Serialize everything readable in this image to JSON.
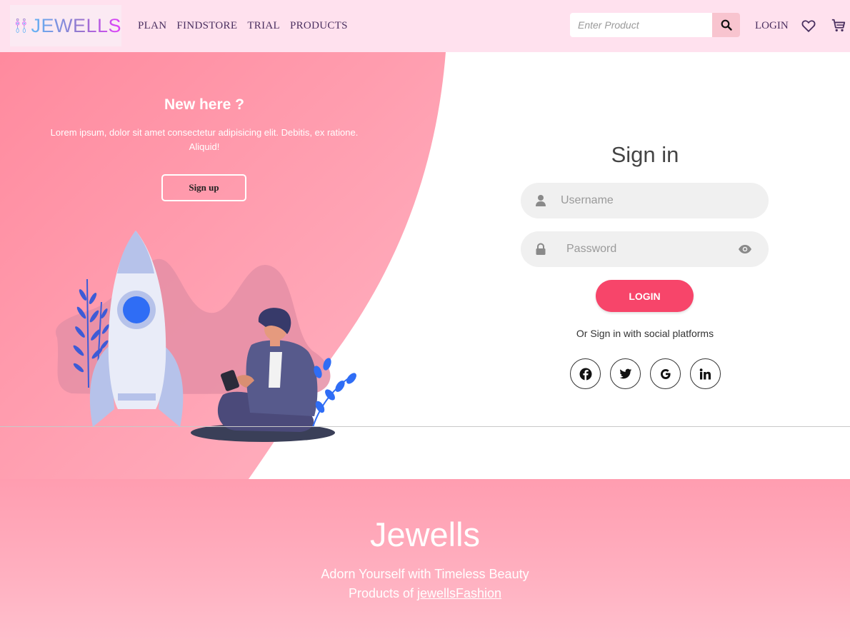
{
  "header": {
    "brand": "JEWELLS",
    "nav": [
      "PLAN",
      "FINDSTORE",
      "TRIAL",
      "PRODUCTS"
    ],
    "search_placeholder": "Enter Product",
    "login_label": "LOGIN",
    "icons": [
      "search-icon",
      "heart-icon",
      "cart-icon"
    ]
  },
  "welcome": {
    "title": "New here ?",
    "text": "Lorem ipsum, dolor sit amet consectetur adipisicing elit. Debitis, ex ratione. Aliquid!",
    "signup_label": "Sign up"
  },
  "signin": {
    "title": "Sign in",
    "username_placeholder": "Username",
    "password_placeholder": "Password",
    "login_label": "LOGIN",
    "social_text": "Or Sign in with social platforms",
    "social": [
      "facebook-icon",
      "twitter-icon",
      "google-icon",
      "linkedin-icon"
    ]
  },
  "footer": {
    "brand": "Jewells",
    "tagline": "Adorn Yourself with Timeless Beauty",
    "credit_prefix": "Products of ",
    "credit_link": "jewellsFashion"
  },
  "colors": {
    "header_bg": "#ffe1ee",
    "accent_pink": "#ff8fa3",
    "login_button": "#f7456a",
    "footer_bg": "#ffa9ba"
  }
}
